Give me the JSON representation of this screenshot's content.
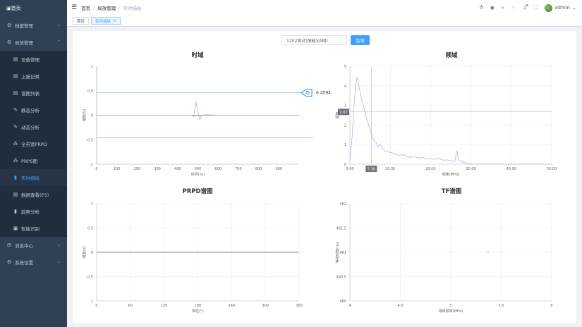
{
  "sidebar": {
    "home": "首页",
    "items": [
      {
        "label": "档案管理",
        "icon": "gear-icon",
        "arrow": "⌄"
      },
      {
        "label": "局放管理",
        "icon": "gear-icon",
        "arrow": "⌃"
      },
      {
        "label": "设备管理",
        "icon": "file-icon"
      },
      {
        "label": "上报记录",
        "icon": "file-icon"
      },
      {
        "label": "谱图列表",
        "icon": "file-icon"
      },
      {
        "label": "静态分析",
        "icon": "edit-icon"
      },
      {
        "label": "动态分析",
        "icon": "edit-icon"
      },
      {
        "label": "全带宽PRPD",
        "icon": "cluster-icon"
      },
      {
        "label": "PRPS图",
        "icon": "cluster-icon"
      },
      {
        "label": "实时描绘",
        "icon": "bar-icon",
        "active": true
      },
      {
        "label": "数据查看(ES)",
        "icon": "file-icon"
      },
      {
        "label": "趋势分析",
        "icon": "bar-icon"
      },
      {
        "label": "智能识别",
        "icon": "image-icon"
      },
      {
        "label": "消息中心",
        "icon": "message-icon",
        "arrow": "⌄"
      },
      {
        "label": "系统设置",
        "icon": "gear-icon",
        "arrow": "⌄"
      }
    ]
  },
  "header": {
    "breadcrumb": [
      "首页",
      "局放管理",
      "实时描绘"
    ],
    "user": "admin"
  },
  "tags": [
    {
      "label": "首页",
      "active": false
    },
    {
      "label": "实时描绘",
      "active": true
    }
  ],
  "controls": {
    "device_select": "1202测试(便能)(A相)",
    "monitor_button": "监测"
  },
  "colors": {
    "accent": "#409eff",
    "sidebar_bg": "#304156",
    "line": "#a8b6e6"
  },
  "chart_data": [
    {
      "id": "time-domain",
      "type": "line",
      "title": "时域",
      "xlabel": "时间(ns)",
      "ylabel": "幅值(V)",
      "xlim": [
        0,
        1000
      ],
      "ylim": [
        -1,
        1
      ],
      "xticks": [
        "0",
        "100",
        "200",
        "300",
        "400",
        "500",
        "600",
        "700",
        "800",
        "900"
      ],
      "yticks": [
        "1",
        "0.5",
        "0",
        "-0.5",
        "-1"
      ],
      "thresholds": [
        0.4594,
        -0.4594
      ],
      "marker_label": "0.4594",
      "points": [
        [
          0,
          0
        ],
        [
          100,
          0
        ],
        [
          200,
          0
        ],
        [
          300,
          0
        ],
        [
          400,
          0
        ],
        [
          470,
          0
        ],
        [
          480,
          -0.03
        ],
        [
          490,
          0.28
        ],
        [
          500,
          0.06
        ],
        [
          510,
          -0.08
        ],
        [
          520,
          0.0
        ],
        [
          540,
          0.01
        ],
        [
          600,
          0
        ],
        [
          700,
          0
        ],
        [
          800,
          0
        ],
        [
          1000,
          0
        ]
      ]
    },
    {
      "id": "freq-domain",
      "type": "line",
      "title": "频域",
      "xlabel": "频率(MHz)",
      "ylabel": "幅值",
      "xlim": [
        0,
        50
      ],
      "ylim": [
        0,
        5
      ],
      "xticks": [
        "0.00",
        "10.00",
        "20.00",
        "30.00",
        "40.00",
        "50.00"
      ],
      "yticks": [
        "5",
        "4",
        "3",
        "2",
        "1",
        "0"
      ],
      "cursor_x": "5.30",
      "cursor_y": "2.67",
      "points": [
        [
          0,
          0.2
        ],
        [
          0.6,
          1.5
        ],
        [
          1,
          2.9
        ],
        [
          1.4,
          4.0
        ],
        [
          1.8,
          4.45
        ],
        [
          2.2,
          4.0
        ],
        [
          2.6,
          3.6
        ],
        [
          3.0,
          3.2
        ],
        [
          3.5,
          2.9
        ],
        [
          4.0,
          2.4
        ],
        [
          4.5,
          2.1
        ],
        [
          5.0,
          1.8
        ],
        [
          5.5,
          1.4
        ],
        [
          6,
          1.2
        ],
        [
          6.5,
          1.1
        ],
        [
          7,
          0.9
        ],
        [
          7.5,
          1.0
        ],
        [
          8,
          0.8
        ],
        [
          9,
          0.65
        ],
        [
          10,
          0.6
        ],
        [
          11,
          0.55
        ],
        [
          12,
          0.45
        ],
        [
          13,
          0.5
        ],
        [
          14,
          0.4
        ],
        [
          15,
          0.35
        ],
        [
          16,
          0.4
        ],
        [
          17,
          0.3
        ],
        [
          18,
          0.35
        ],
        [
          19,
          0.28
        ],
        [
          20,
          0.3
        ],
        [
          21,
          0.25
        ],
        [
          22,
          0.3
        ],
        [
          23,
          0.2
        ],
        [
          24,
          0.22
        ],
        [
          25,
          0.18
        ],
        [
          26,
          0.15
        ],
        [
          26.5,
          0.7
        ],
        [
          27,
          0.2
        ],
        [
          28,
          0.1
        ],
        [
          29,
          0.05
        ],
        [
          30,
          0.02
        ],
        [
          32,
          0.0
        ],
        [
          50,
          0.0
        ]
      ]
    },
    {
      "id": "prpd",
      "type": "scatter",
      "title": "PRPD谱图",
      "xlabel": "相位(°)",
      "ylabel": "幅值(V)",
      "xlim": [
        0,
        360
      ],
      "ylim": [
        -1,
        1
      ],
      "xticks": [
        "0",
        "60",
        "120",
        "180",
        "240",
        "300",
        "360"
      ],
      "yticks": [
        "1",
        "0.5",
        "0",
        "-0.5",
        "-1"
      ]
    },
    {
      "id": "tf",
      "type": "scatter",
      "title": "TF谱图",
      "xlabel": "等效频率(MHz)",
      "ylabel": "等效时宽(ns)",
      "xlim": [
        4,
        6
      ],
      "ylim": [
        460,
        462
      ],
      "xticks": [
        "4",
        "4.5",
        "5",
        "5.5",
        "6"
      ],
      "yticks": [
        "462",
        "461.5",
        "461",
        "460.5",
        "460"
      ],
      "points": [
        [
          5.37,
          461.02
        ]
      ]
    }
  ]
}
